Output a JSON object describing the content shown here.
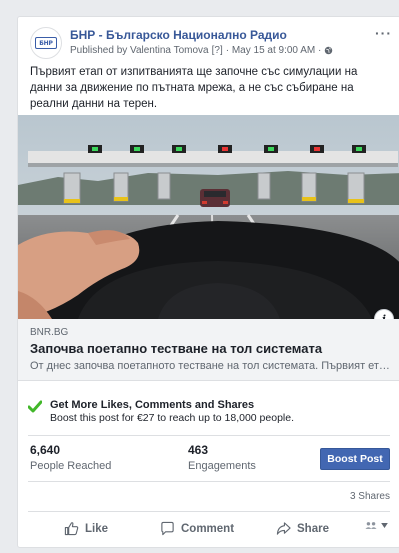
{
  "post": {
    "page_name": "БНР - Българско Национално Радио",
    "published_by": "Published by Valentina Tomova",
    "meta_marker": "[?]",
    "date": "· May 15 at 9:00 AM ·",
    "more": "···",
    "avatar_text": "БНР",
    "text": "Първият етап от изпитванията ще започне със симулации на данни за движение по пътната мрежа, а не със събиране на реални данни на терен."
  },
  "link": {
    "domain": "BNR.BG",
    "title": "Започва поетапно тестване на тол системата",
    "description": "От днес започва поетапното тестване на тол системата. Първият ета..."
  },
  "boost": {
    "title": "Get More Likes, Comments and Shares",
    "subtitle": "Boost this post for €27 to reach up to 18,000 people."
  },
  "stats": {
    "reached_value": "6,640",
    "reached_label": "People Reached",
    "engagements_value": "463",
    "engagements_label": "Engagements",
    "boost_button": "Boost Post",
    "shares": "3 Shares"
  },
  "actions": {
    "like": "Like",
    "comment": "Comment",
    "share": "Share"
  },
  "colors": {
    "link_blue": "#385898",
    "boost_blue": "#4267b2",
    "check_green": "#42b72a"
  }
}
